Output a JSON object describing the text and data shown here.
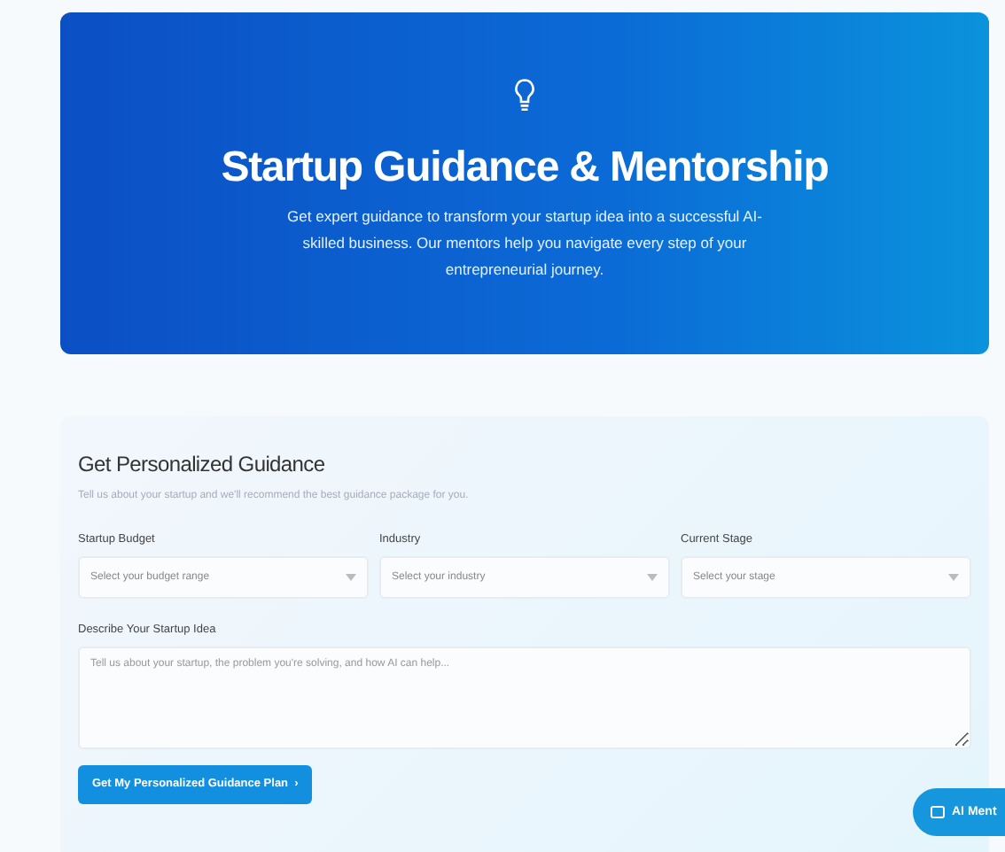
{
  "hero": {
    "title": "Startup Guidance & Mentorship",
    "subtitle": "Get expert guidance to transform your startup idea into a successful AI-skilled business. Our mentors help you navigate every step of your entrepreneurial journey."
  },
  "form": {
    "title": "Get Personalized Guidance",
    "description": "Tell us about your startup and we'll recommend the best guidance package for you.",
    "selects": [
      {
        "label": "Startup Budget",
        "placeholder": "Select your budget range"
      },
      {
        "label": "Industry",
        "placeholder": "Select your industry"
      },
      {
        "label": "Current Stage",
        "placeholder": "Select your stage"
      }
    ],
    "idea": {
      "label": "Describe Your Startup Idea",
      "placeholder": "Tell us about your startup, the problem you're solving, and how AI can help..."
    },
    "submit": {
      "label": "Get My Personalized Guidance Plan",
      "arrow": "›"
    }
  },
  "chat_button": {
    "label": "AI Ment"
  }
}
